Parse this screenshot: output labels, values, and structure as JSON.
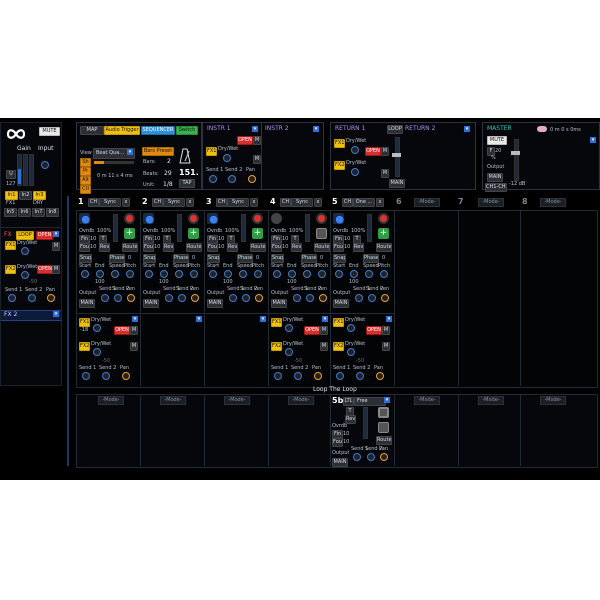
{
  "left": {
    "mute_label": "MUTE",
    "gain_label": "Gain",
    "input_label": "Input",
    "u_label": "U",
    "gain_value": "127",
    "fx1_label": "FX1",
    "dry_label": "DRY",
    "inputs_row1": [
      "In1",
      "In2",
      "In3"
    ],
    "inputs_row2": [
      "In5",
      "In6",
      "In7",
      "In8"
    ],
    "fx_title": "FX",
    "loop_label": "LOOP",
    "open_label": "OPEN",
    "m_label": "M",
    "fx1_badge": "FX1",
    "drywet_label": "Dry/Wet",
    "fx2_badge": "FX2",
    "val_50": "-50",
    "sends": [
      "Send 1",
      "Send 2",
      "Pan"
    ],
    "fx2_footer": "FX 2"
  },
  "top": {
    "map_label": "MAP",
    "audio_trigger": "Audio Trigger",
    "sequencer": "SEQUENCER",
    "switch": "Switch",
    "view_label": "View",
    "view_value": "Beat Qua...",
    "bars_preset": "Bars Preset",
    "bars_label": "Bars:",
    "bars_value": "2",
    "beats_label": "Beats:",
    "beats_value": "29",
    "unit_label": "Unit:",
    "unit_value": "1/8",
    "tempo_value": "151.",
    "tap_label": "TAP",
    "time_display": "0 m 11 s 4 ms",
    "side_buttons": [
      "Sh",
      "Pr",
      "Alt",
      "Ctl"
    ],
    "instr1": "INSTR 1",
    "instr2": "INSTR 2",
    "open_label": "OPEN",
    "m_label": "M",
    "fx1": "FX1",
    "fx2": "FX2",
    "drywet": "Dry/Wet",
    "sends": [
      "Send 1",
      "Send 2",
      "Pan"
    ],
    "return1": "RETURN 1",
    "return2": "RETURN 2",
    "loop_label": "LOOP",
    "main_label": "MAIN",
    "master_label": "MASTER",
    "mute_label": "MUTE",
    "master_time": "0 m 0 s 0ms",
    "f_label": "F",
    "f_value": "20",
    "pct": "%",
    "output_label": "Output",
    "ch_label": "CH1-CH2",
    "db_value": "-12 dB"
  },
  "slots_header": [
    {
      "num": "1",
      "ch": "CH",
      "sync": "Sync",
      "x": "x"
    },
    {
      "num": "2",
      "ch": "CH",
      "sync": "Sync",
      "x": "x"
    },
    {
      "num": "3",
      "ch": "CH",
      "sync": "Sync",
      "x": "x"
    },
    {
      "num": "4",
      "ch": "CH",
      "sync": "Sync",
      "x": "x"
    },
    {
      "num": "5",
      "ch": "CH",
      "sync": "One ...",
      "x": "x"
    }
  ],
  "empty_slots": [
    {
      "num": "6",
      "mode": "-Mode-"
    },
    {
      "num": "7",
      "mode": "-Mode-"
    },
    {
      "num": "8",
      "mode": "-Mode-"
    }
  ],
  "slot_labels": {
    "ovrdb": "Ovrdb",
    "pct100": "100%",
    "fin": "Fin",
    "fout": "Fout",
    "t": "T",
    "rev": "Rev",
    "v10": "10",
    "route": "Route",
    "snap": "Snap",
    "phase": "Phase",
    "zero": "0",
    "start": "Start",
    "end": "End",
    "speed": "Speed",
    "pitch": "Pitch",
    "v100": "100",
    "output": "Output",
    "main": "MAIN",
    "send1": "Send 1",
    "send2": "Send 2",
    "pan": "Pen"
  },
  "slot_fx": {
    "fx1": "FX1",
    "fx2": "FX2",
    "drywet": "Dry/Wet",
    "open": "OPEN",
    "m": "M",
    "val_18": "-18",
    "val_50": "-50",
    "sends": [
      "Send 1",
      "Send 2",
      "Pan"
    ]
  },
  "loop_title": "Loop The Loop",
  "bottom_modes": [
    "-Mode-",
    "-Mode-",
    "-Mode-",
    "-Mode-",
    "-Mode-",
    "-Mode-",
    "-Mode-",
    "-Mode-"
  ],
  "loop5b": {
    "num": "5b",
    "ltl": "LTL",
    "free": "Free",
    "t": "T",
    "rev": "Rev",
    "ovrdb": "Ovrdb",
    "fin": "Fin",
    "fout": "Fout",
    "v10": "10",
    "route": "Route",
    "output": "Output",
    "main": "MAIN",
    "send1": "Send 1",
    "send2": "Send 2",
    "pan": "Pan"
  }
}
